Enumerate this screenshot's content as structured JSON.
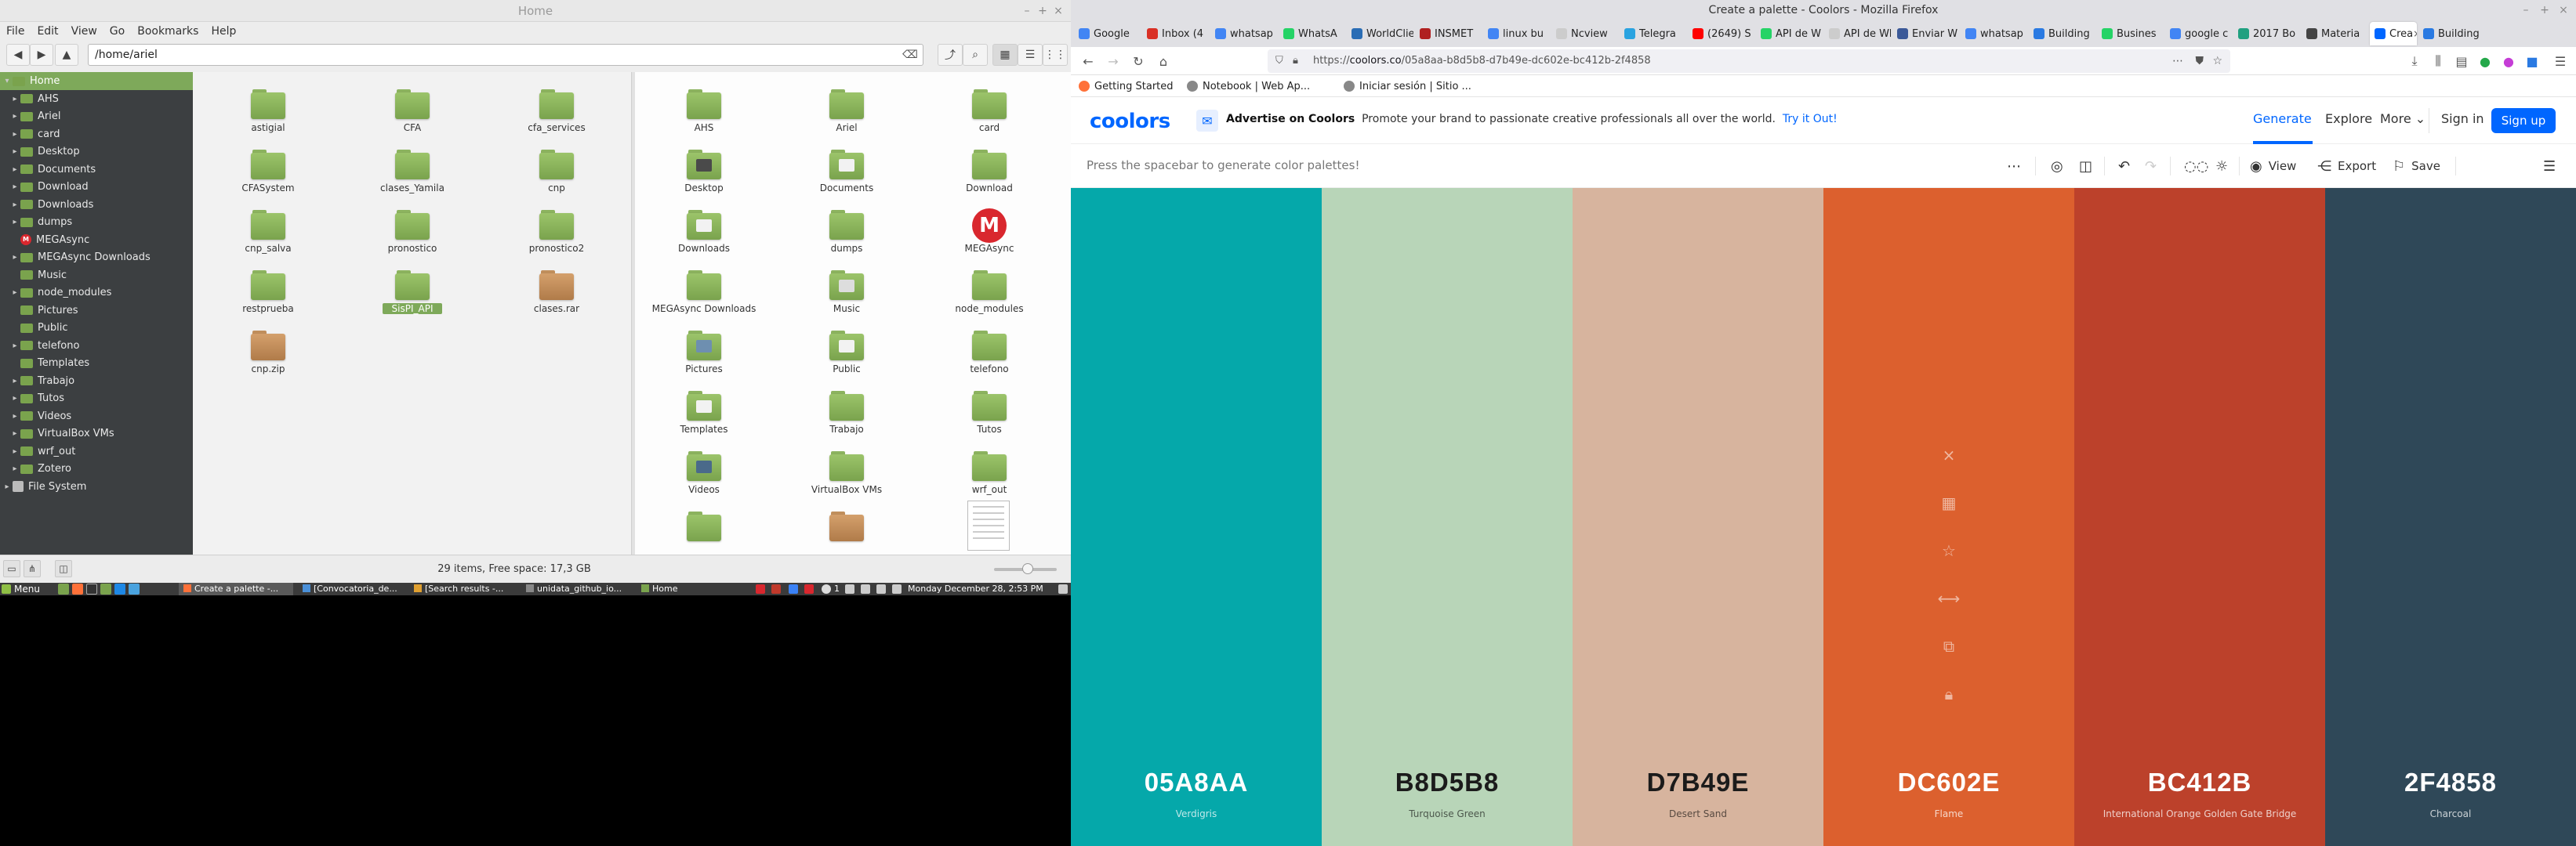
{
  "file_manager": {
    "title": "Home",
    "menu": [
      "File",
      "Edit",
      "View",
      "Go",
      "Bookmarks",
      "Help"
    ],
    "location": "/home/ariel",
    "sidebar": [
      {
        "label": "Home",
        "selected": true,
        "expanded": true,
        "depth": 0,
        "icon": "home"
      },
      {
        "label": "AHS",
        "depth": 1,
        "arrow": true
      },
      {
        "label": "Ariel",
        "depth": 1,
        "arrow": true
      },
      {
        "label": "card",
        "depth": 1,
        "arrow": true
      },
      {
        "label": "Desktop",
        "depth": 1,
        "arrow": true
      },
      {
        "label": "Documents",
        "depth": 1,
        "arrow": true
      },
      {
        "label": "Download",
        "depth": 1,
        "arrow": true
      },
      {
        "label": "Downloads",
        "depth": 1,
        "arrow": true
      },
      {
        "label": "dumps",
        "depth": 1,
        "arrow": true
      },
      {
        "label": "MEGAsync",
        "depth": 1,
        "arrow": false,
        "icon": "mega"
      },
      {
        "label": "MEGAsync Downloads",
        "depth": 1,
        "arrow": true
      },
      {
        "label": "Music",
        "depth": 1,
        "arrow": false
      },
      {
        "label": "node_modules",
        "depth": 1,
        "arrow": true
      },
      {
        "label": "Pictures",
        "depth": 1,
        "arrow": false
      },
      {
        "label": "Public",
        "depth": 1,
        "arrow": false
      },
      {
        "label": "telefono",
        "depth": 1,
        "arrow": true
      },
      {
        "label": "Templates",
        "depth": 1,
        "arrow": false
      },
      {
        "label": "Trabajo",
        "depth": 1,
        "arrow": true
      },
      {
        "label": "Tutos",
        "depth": 1,
        "arrow": true
      },
      {
        "label": "Videos",
        "depth": 1,
        "arrow": true
      },
      {
        "label": "VirtualBox VMs",
        "depth": 1,
        "arrow": true
      },
      {
        "label": "wrf_out",
        "depth": 1,
        "arrow": true
      },
      {
        "label": "Zotero",
        "depth": 1,
        "arrow": true
      },
      {
        "label": "File System",
        "depth": 0,
        "arrow": true,
        "icon": "fs"
      }
    ],
    "left_pane": [
      {
        "label": "astigial",
        "type": "folder"
      },
      {
        "label": "CFA",
        "type": "folder"
      },
      {
        "label": "cfa_services",
        "type": "folder"
      },
      {
        "label": "CFASystem",
        "type": "folder"
      },
      {
        "label": "clases_Yamila",
        "type": "folder"
      },
      {
        "label": "cnp",
        "type": "folder"
      },
      {
        "label": "cnp_salva",
        "type": "folder"
      },
      {
        "label": "pronostico",
        "type": "folder"
      },
      {
        "label": "pronostico2",
        "type": "folder"
      },
      {
        "label": "restprueba",
        "type": "folder"
      },
      {
        "label": "SisPI_API",
        "type": "folder",
        "highlighted": true
      },
      {
        "label": "clases.rar",
        "type": "archive"
      },
      {
        "label": "cnp.zip",
        "type": "archive"
      }
    ],
    "right_pane": [
      {
        "label": "AHS",
        "type": "folder"
      },
      {
        "label": "Ariel",
        "type": "folder"
      },
      {
        "label": "card",
        "type": "folder"
      },
      {
        "label": "Desktop",
        "type": "desktop"
      },
      {
        "label": "Documents",
        "type": "documents"
      },
      {
        "label": "Download",
        "type": "folder"
      },
      {
        "label": "Downloads",
        "type": "downloads"
      },
      {
        "label": "dumps",
        "type": "folder"
      },
      {
        "label": "MEGAsync",
        "type": "mega"
      },
      {
        "label": "MEGAsync Downloads",
        "type": "folder"
      },
      {
        "label": "Music",
        "type": "music"
      },
      {
        "label": "node_modules",
        "type": "folder"
      },
      {
        "label": "Pictures",
        "type": "pictures"
      },
      {
        "label": "Public",
        "type": "public"
      },
      {
        "label": "telefono",
        "type": "folder"
      },
      {
        "label": "Templates",
        "type": "templates"
      },
      {
        "label": "Trabajo",
        "type": "folder"
      },
      {
        "label": "Tutos",
        "type": "folder"
      },
      {
        "label": "Videos",
        "type": "videos"
      },
      {
        "label": "VirtualBox VMs",
        "type": "folder"
      },
      {
        "label": "wrf_out",
        "type": "folder"
      },
      {
        "label": "",
        "type": "folder"
      },
      {
        "label": "",
        "type": "archive"
      },
      {
        "label": "",
        "type": "document"
      }
    ],
    "status": "29 items, Free space: 17,3 GB"
  },
  "taskbar": {
    "menu_label": "Menu",
    "windows": [
      {
        "label": "Create a palette -...",
        "active": true,
        "color": "#ff7139"
      },
      {
        "label": "[Convocatoria_de...",
        "active": false,
        "color": "#4a90d9"
      },
      {
        "label": "[Search results -...",
        "active": false,
        "color": "#e0a030"
      },
      {
        "label": "unidata_github_io...",
        "active": false,
        "color": "#888888"
      },
      {
        "label": "Home",
        "active": false,
        "color": "#7aa34d"
      }
    ],
    "clock": "Monday December 28,  2:53 PM",
    "tray_count": "1"
  },
  "browser": {
    "window_title": "Create a palette - Coolors - Mozilla Firefox",
    "tabs": [
      {
        "label": "Google",
        "color": "#4285f4"
      },
      {
        "label": "Inbox (4",
        "color": "#d93025"
      },
      {
        "label": "whatsap",
        "color": "#4285f4"
      },
      {
        "label": "WhatsA",
        "color": "#25d366"
      },
      {
        "label": "WorldClient",
        "color": "#2a6db5"
      },
      {
        "label": "INSMET",
        "color": "#b02020"
      },
      {
        "label": "linux bu",
        "color": "#4285f4"
      },
      {
        "label": "Ncview",
        "color": "#cccccc"
      },
      {
        "label": "Telegra",
        "color": "#2aa3e0"
      },
      {
        "label": "(2649) S",
        "color": "#ff0000"
      },
      {
        "label": "API de W",
        "color": "#25d366"
      },
      {
        "label": "API de Wha",
        "color": "#cccccc"
      },
      {
        "label": "Enviar W",
        "color": "#3b5998"
      },
      {
        "label": "whatsap",
        "color": "#4285f4"
      },
      {
        "label": "Building",
        "color": "#2a7ae2"
      },
      {
        "label": "Busines",
        "color": "#25d366"
      },
      {
        "label": "google c",
        "color": "#4285f4"
      },
      {
        "label": "2017 Bo",
        "color": "#20a080"
      },
      {
        "label": "Materia",
        "color": "#444444"
      },
      {
        "label": "Crea",
        "color": "#0066ff",
        "active": true
      },
      {
        "label": "Building",
        "color": "#2a7ae2"
      }
    ],
    "url_host": "coolors.co",
    "url_rest": "/05a8aa-b8d5b8-d7b49e-dc602e-bc412b-2f4858",
    "url_scheme": "https://",
    "bookmarks": [
      {
        "label": "Getting Started",
        "color": "#ff7139"
      },
      {
        "label": "Notebook | Web Ap...",
        "color": "#888888"
      },
      {
        "label": "Iniciar sesión | Sitio ...",
        "color": "#888888"
      }
    ]
  },
  "coolors": {
    "logo": "coolors",
    "ad_title": "Advertise on Coolors",
    "ad_text": "Promote your brand to passionate creative professionals all over the world.",
    "ad_cta": "Try it Out!",
    "nav": {
      "generate": "Generate",
      "explore": "Explore",
      "more": "More",
      "signin": "Sign in",
      "signup": "Sign up"
    },
    "hint": "Press the spacebar to generate color palettes!",
    "tools": {
      "view": "View",
      "export": "Export",
      "save": "Save"
    },
    "palette": [
      {
        "hex": "05A8AA",
        "name": "Verdigris",
        "color": "#05a8aa",
        "text": "#ffffff",
        "sub": "rgba(255,255,255,0.75)"
      },
      {
        "hex": "B8D5B8",
        "name": "Turquoise Green",
        "color": "#b8d5b8",
        "text": "#1b1b1b",
        "sub": "rgba(0,0,0,0.6)"
      },
      {
        "hex": "D7B49E",
        "name": "Desert Sand",
        "color": "#d7b49e",
        "text": "#1b1b1b",
        "sub": "rgba(0,0,0,0.6)"
      },
      {
        "hex": "DC602E",
        "name": "Flame",
        "color": "#dc602e",
        "text": "#ffffff",
        "sub": "rgba(255,255,255,0.75)"
      },
      {
        "hex": "BC412B",
        "name": "International Orange Golden Gate Bridge",
        "color": "#bc412b",
        "text": "#ffffff",
        "sub": "rgba(255,255,255,0.75)"
      },
      {
        "hex": "2F4858",
        "name": "Charcoal",
        "color": "#2f4858",
        "text": "#ffffff",
        "sub": "rgba(255,255,255,0.75)"
      }
    ],
    "hover_tools": [
      "close-icon",
      "grid-icon",
      "star-icon",
      "drag-arrows-icon",
      "copy-icon",
      "lock-icon"
    ]
  }
}
